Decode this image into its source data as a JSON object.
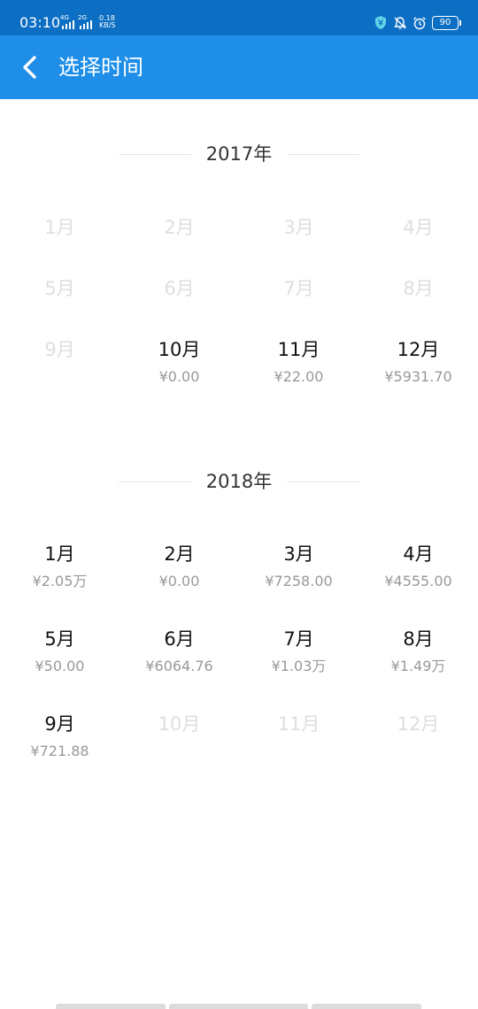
{
  "status": {
    "time": "03:10",
    "sim1": "4G",
    "sim2": "2G",
    "speed_value": "0.18",
    "speed_unit": "KB/S",
    "battery": "90"
  },
  "header": {
    "title": "选择时间"
  },
  "years": [
    {
      "label": "2017年",
      "months": [
        {
          "label": "1月",
          "value": "",
          "enabled": false
        },
        {
          "label": "2月",
          "value": "",
          "enabled": false
        },
        {
          "label": "3月",
          "value": "",
          "enabled": false
        },
        {
          "label": "4月",
          "value": "",
          "enabled": false
        },
        {
          "label": "5月",
          "value": "",
          "enabled": false
        },
        {
          "label": "6月",
          "value": "",
          "enabled": false
        },
        {
          "label": "7月",
          "value": "",
          "enabled": false
        },
        {
          "label": "8月",
          "value": "",
          "enabled": false
        },
        {
          "label": "9月",
          "value": "",
          "enabled": false
        },
        {
          "label": "10月",
          "value": "¥0.00",
          "enabled": true
        },
        {
          "label": "11月",
          "value": "¥22.00",
          "enabled": true
        },
        {
          "label": "12月",
          "value": "¥5931.70",
          "enabled": true
        }
      ]
    },
    {
      "label": "2018年",
      "months": [
        {
          "label": "1月",
          "value": "¥2.05万",
          "enabled": true
        },
        {
          "label": "2月",
          "value": "¥0.00",
          "enabled": true
        },
        {
          "label": "3月",
          "value": "¥7258.00",
          "enabled": true
        },
        {
          "label": "4月",
          "value": "¥4555.00",
          "enabled": true
        },
        {
          "label": "5月",
          "value": "¥50.00",
          "enabled": true
        },
        {
          "label": "6月",
          "value": "¥6064.76",
          "enabled": true
        },
        {
          "label": "7月",
          "value": "¥1.03万",
          "enabled": true
        },
        {
          "label": "8月",
          "value": "¥1.49万",
          "enabled": true
        },
        {
          "label": "9月",
          "value": "¥721.88",
          "enabled": true
        },
        {
          "label": "10月",
          "value": "",
          "enabled": false
        },
        {
          "label": "11月",
          "value": "",
          "enabled": false
        },
        {
          "label": "12月",
          "value": "",
          "enabled": false
        }
      ]
    }
  ]
}
